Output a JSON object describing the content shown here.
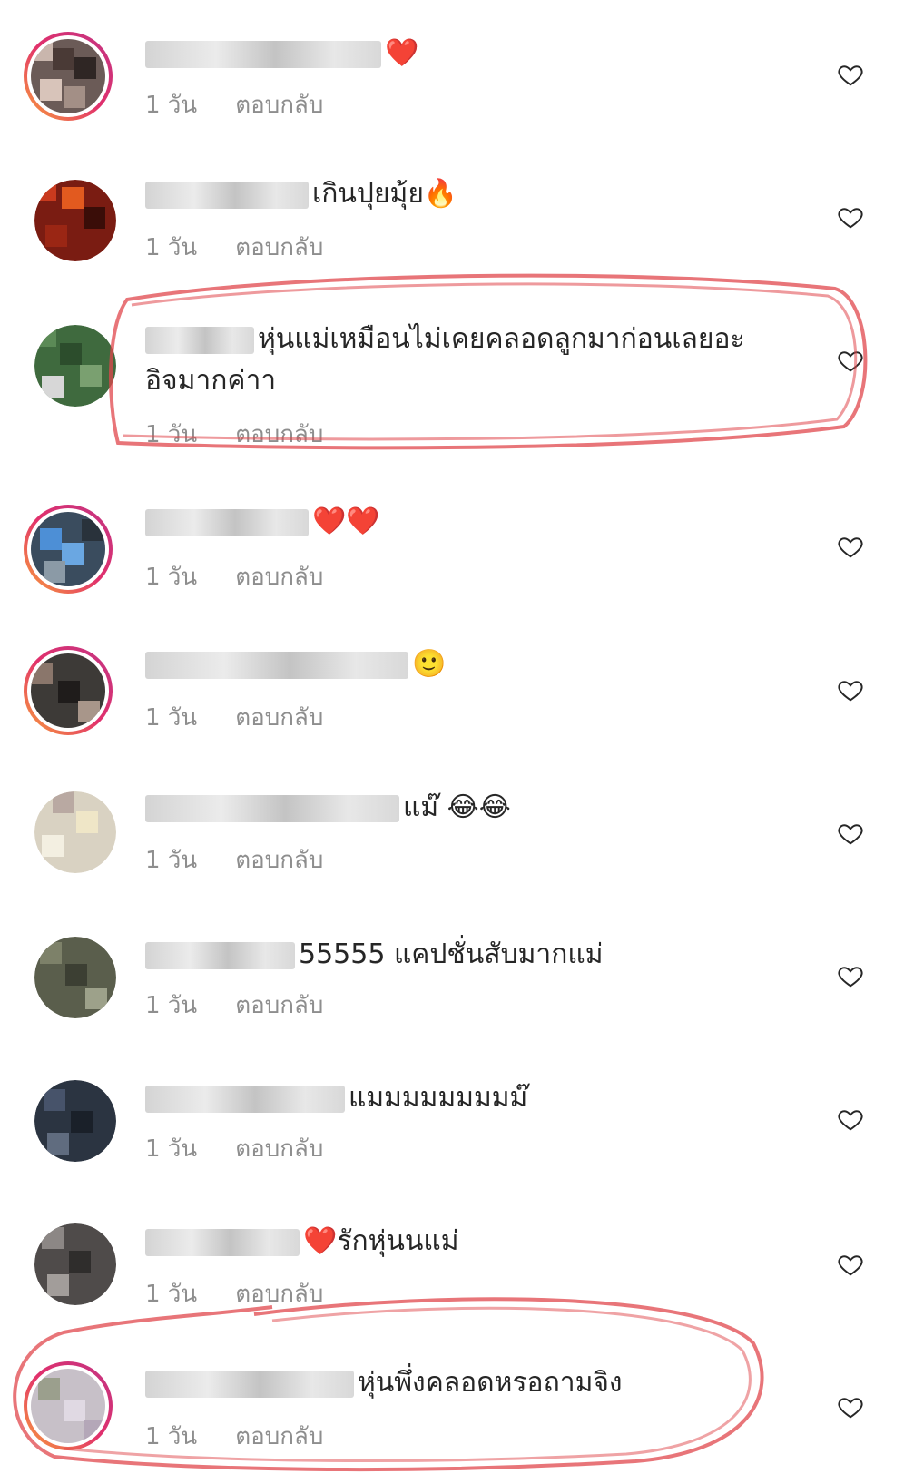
{
  "comments": [
    {
      "text": "",
      "emoji": "❤️",
      "time": "1 วัน",
      "reply": "ตอบกลับ"
    },
    {
      "text": "เกินปุยมุ้ย",
      "emoji": "🔥",
      "time": "1 วัน",
      "reply": "ตอบกลับ"
    },
    {
      "text": "หุ่นแม่เหมือนไม่เคยคลอดลูกมาก่อนเลยอะ",
      "text2": "อิจมากค่าา",
      "time": "1 วัน",
      "reply": "ตอบกลับ"
    },
    {
      "text": "",
      "emoji": "❤️❤️",
      "time": "1 วัน",
      "reply": "ตอบกลับ"
    },
    {
      "text": "",
      "time": "1 วัน",
      "reply": "ตอบกลับ"
    },
    {
      "text": "แม๊",
      "emoji": "😂😂",
      "time": "1 วัน",
      "reply": "ตอบกลับ"
    },
    {
      "text": "55555 แคปชั่นสับมากแม่",
      "time": "1 วัน",
      "reply": "ตอบกลับ"
    },
    {
      "text": "แมมมมมมมมม๊",
      "time": "1 วัน",
      "reply": "ตอบกลับ"
    },
    {
      "text": "รักหุ่นนแม่",
      "emoji": "❤️",
      "time": "1 วัน",
      "reply": "ตอบกลับ"
    },
    {
      "text": "หุ่นพึ่งคลอดหรอถามจิง",
      "time": "1 วัน",
      "reply": "ตอบกลับ"
    }
  ],
  "colors": {
    "annotation": "#e0474c",
    "muted": "#8e8e8e",
    "text": "#262626"
  },
  "icons": {
    "like": "heart-outline-icon"
  }
}
